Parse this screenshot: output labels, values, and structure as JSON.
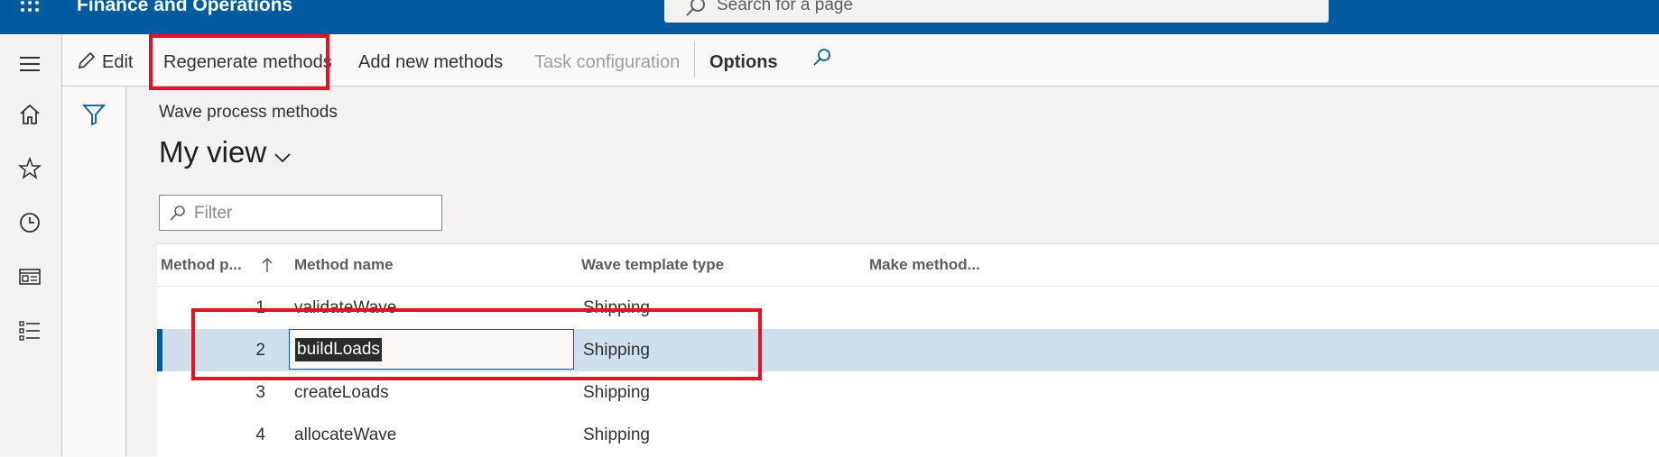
{
  "topbar": {
    "app_title": "Finance and Operations",
    "search_placeholder": "Search for a page",
    "colors": {
      "bar": "#005a9e"
    }
  },
  "navrail": {
    "items": [
      "menu-icon",
      "home-icon",
      "star-icon",
      "recent-icon",
      "workspace-icon",
      "modules-list-icon"
    ]
  },
  "actionpane": {
    "edit": "Edit",
    "regenerate": "Regenerate methods",
    "add_new": "Add new methods",
    "task_config": "Task configuration",
    "options": "Options"
  },
  "page": {
    "caption": "Wave process methods",
    "view_title": "My view",
    "filter_placeholder": "Filter"
  },
  "grid": {
    "columns": [
      "Method p...",
      "Method name",
      "Wave template type",
      "Make method..."
    ],
    "rows": [
      {
        "num": "1",
        "name": "validateWave",
        "type": "Shipping"
      },
      {
        "num": "2",
        "name": "buildLoads",
        "type": "Shipping",
        "selected": true
      },
      {
        "num": "3",
        "name": "createLoads",
        "type": "Shipping"
      },
      {
        "num": "4",
        "name": "allocateWave",
        "type": "Shipping"
      }
    ]
  },
  "annotations": {
    "color": "#e81123"
  }
}
